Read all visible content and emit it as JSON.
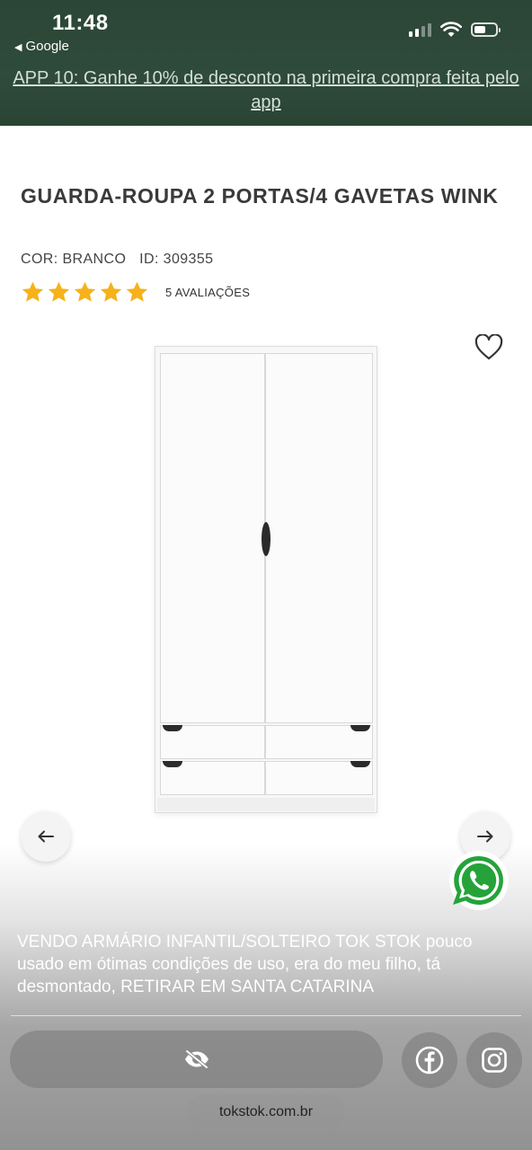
{
  "status_bar": {
    "time": "11:48",
    "back_app": "Google",
    "back_icon": "back-triangle-icon",
    "battery_level": 0.55
  },
  "promo_banner": {
    "text": "APP 10: Ganhe 10% de desconto na primeira compra feita pelo app"
  },
  "product": {
    "title": "GUARDA-ROUPA 2 PORTAS/4 GAVETAS WINK",
    "color": "COR: BRANCO",
    "id": "ID: 309355",
    "rating": 5,
    "rating_max": 5,
    "reviews_label": "5 AVALIAÇÕES",
    "star_color": "#f5b21a"
  },
  "icons": {
    "favorite": "heart-icon",
    "prev": "arrow-left-icon",
    "next": "arrow-right-icon",
    "whatsapp": "whatsapp-icon",
    "hide": "eye-slash-icon",
    "facebook": "facebook-icon",
    "instagram": "instagram-icon"
  },
  "story": {
    "caption": "VENDO ARMÁRIO INFANTIL/SOLTEIRO TOK STOK pouco usado em ótimas condições de uso, era do meu filho, tá desmontado, RETIRAR EM SANTA CATARINA",
    "link_label": "tokstok.com.br"
  },
  "colors": {
    "header_green": "#2e4a3a",
    "whatsapp_green": "#25a33a"
  }
}
